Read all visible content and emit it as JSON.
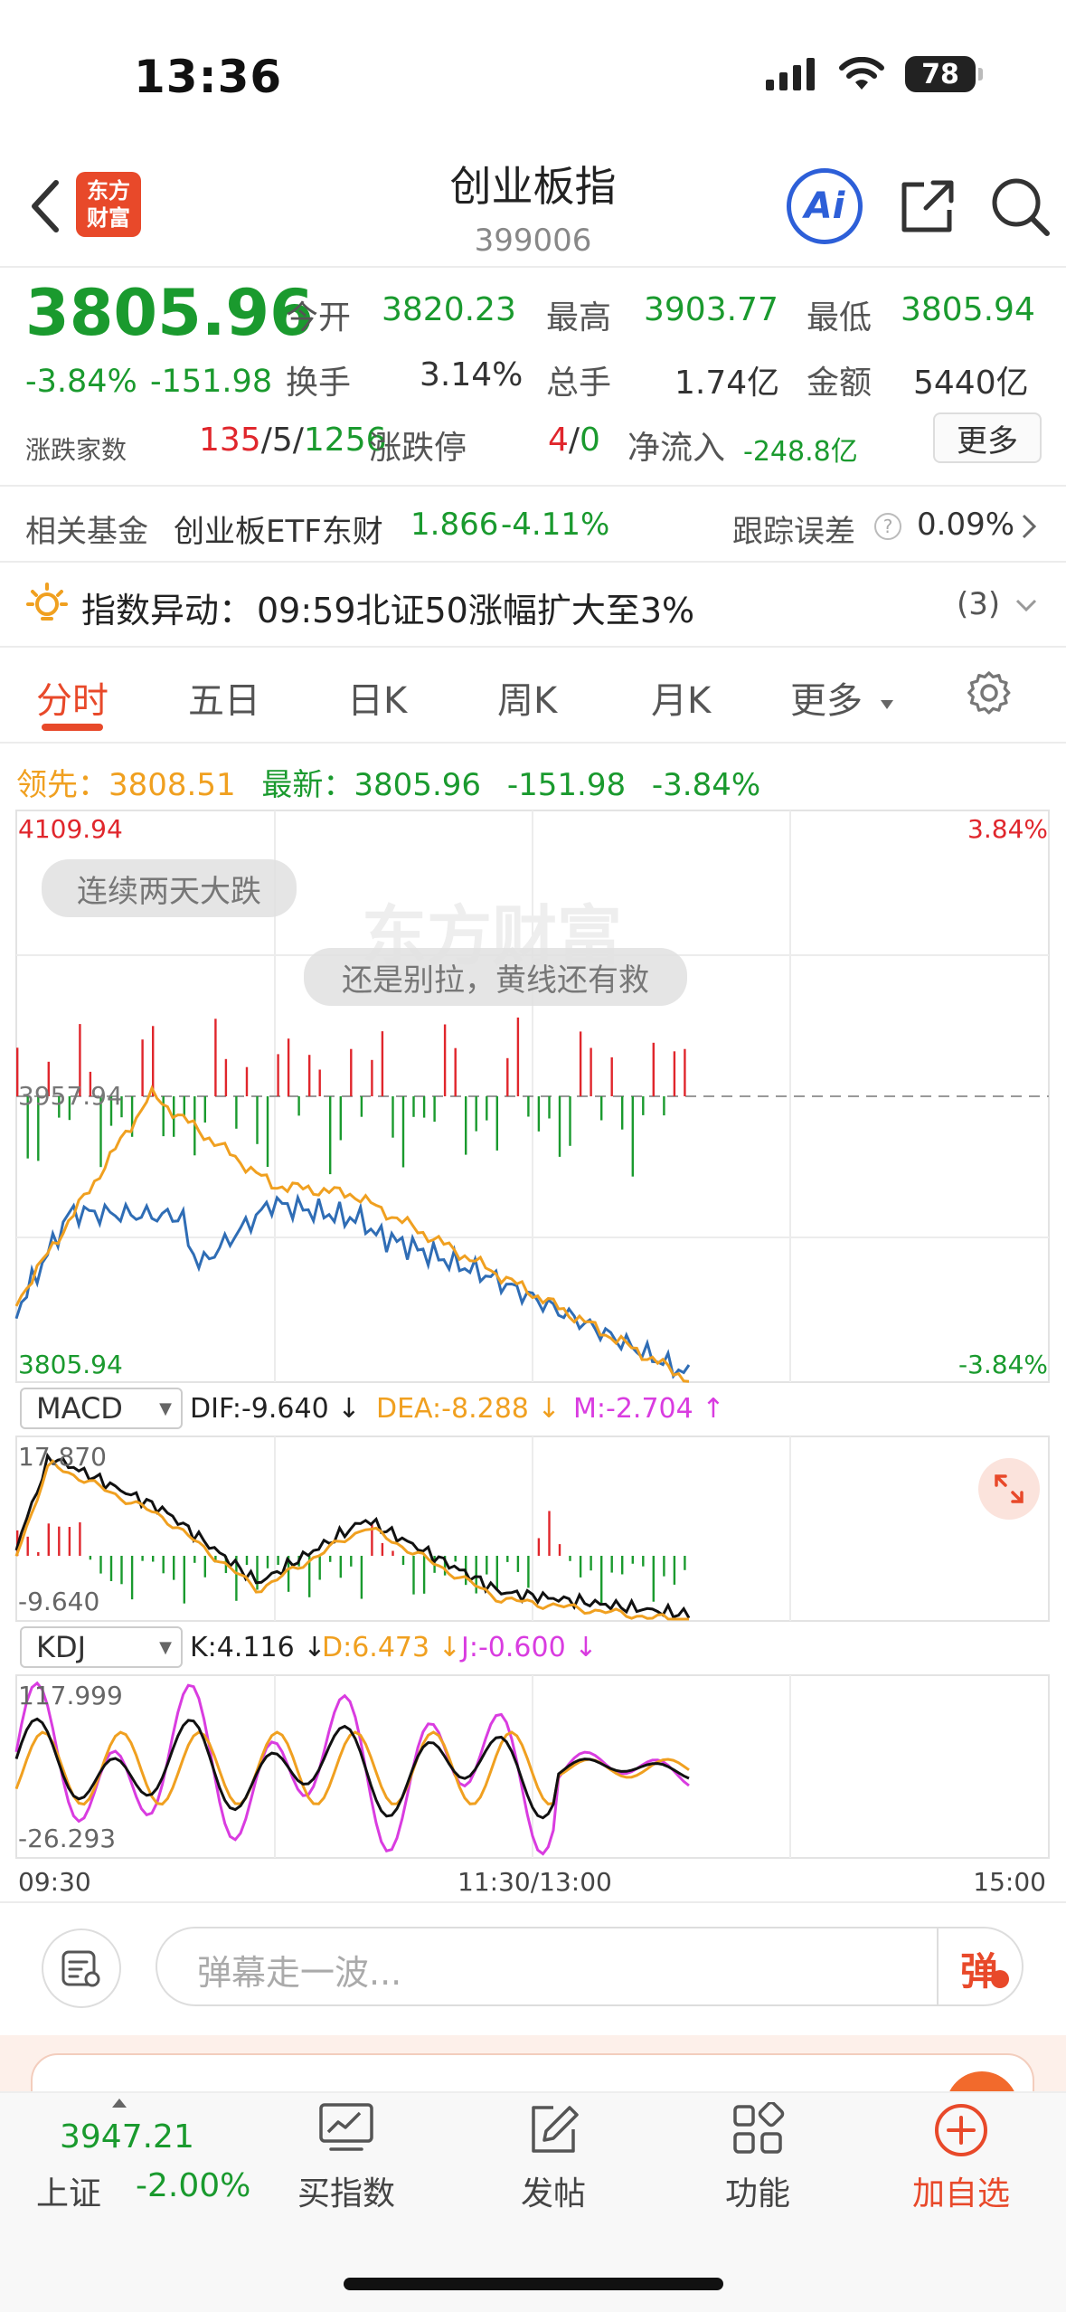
{
  "status": {
    "time": "13:36",
    "battery": "78"
  },
  "header": {
    "logo_line1": "东方",
    "logo_line2": "财富",
    "title": "创业板指",
    "code": "399006",
    "ai_label": "Ai"
  },
  "quote": {
    "price": "3805.96",
    "change_pct": "-3.84%",
    "change_abs": "-151.98",
    "open_label": "今开",
    "open": "3820.23",
    "high_label": "最高",
    "high": "3903.77",
    "low_label": "最低",
    "low": "3805.94",
    "turnover_label": "换手",
    "turnover": "3.14%",
    "volume_label": "总手",
    "volume": "1.74亿",
    "amount_label": "金额",
    "amount": "5440亿",
    "breadth_label": "涨跌家数",
    "breadth_up": "135",
    "breadth_flat": "5",
    "breadth_down": "1256",
    "limit_label": "涨跌停",
    "limit_up": "4",
    "limit_down": "0",
    "netflow_label": "净流入",
    "netflow": "-248.8亿",
    "more_label": "更多"
  },
  "fund": {
    "label": "相关基金",
    "name": "创业板ETF东财",
    "price": "1.866",
    "change": "-4.11%",
    "tracking_label": "跟踪误差",
    "tracking": "0.09%"
  },
  "alert": {
    "label": "指数异动：",
    "text": "09:59北证50涨幅扩大至3%",
    "count": "(3)"
  },
  "tabs": [
    "分时",
    "五日",
    "日K",
    "周K",
    "月K",
    "更多"
  ],
  "chart_info": {
    "lead_label": "领先：",
    "lead": "3808.51",
    "latest_label": "最新：",
    "latest": "3805.96",
    "change_abs": "-151.98",
    "change_pct": "-3.84%"
  },
  "main_chart": {
    "y_top": "4109.94",
    "y_mid": "3957.94",
    "y_bottom": "3805.94",
    "pct_top": "3.84%",
    "pct_bottom": "-3.84%",
    "bubble1": "连续两天大跌",
    "bubble2": "还是别拉，黄线还有救",
    "watermark": "东方财富"
  },
  "macd": {
    "name": "MACD",
    "dif": "DIF:-9.640 ↓",
    "dea": "DEA:-8.288 ↓",
    "m": "M:-2.704 ↑",
    "y_top": "17.870",
    "y_bottom": "-9.640"
  },
  "kdj": {
    "name": "KDJ",
    "k": "K:4.116 ↓",
    "d": "D:6.473 ↓",
    "j": "J:-0.600 ↓",
    "y_top": "117.999",
    "y_bottom": "-26.293"
  },
  "time_axis": {
    "start": "09:30",
    "mid": "11:30/13:00",
    "end": "15:00"
  },
  "comment": {
    "placeholder": "弹幕走一波...",
    "danmu": "弹"
  },
  "bottom_nav": {
    "index_price": "3947.21",
    "index_name": "上证",
    "index_change": "-2.00%",
    "buy": "买指数",
    "post": "发帖",
    "func": "功能",
    "add": "加自选"
  },
  "colors": {
    "up": "#e0262c",
    "down": "#1a9a2e",
    "accent": "#e8492a",
    "price_line": "#2f6db5",
    "avg_line": "#f0a020",
    "brand_blue": "#2d5fd8"
  }
}
